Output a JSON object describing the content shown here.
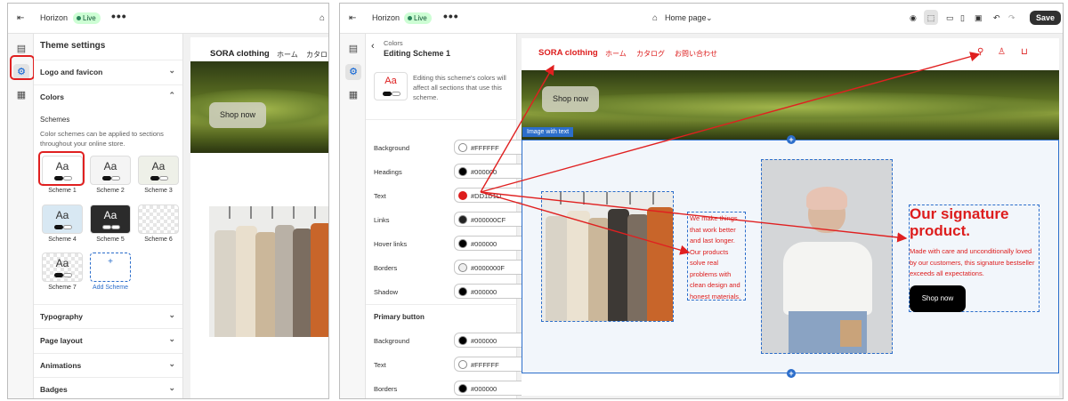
{
  "left": {
    "store": "Horizon",
    "live": "Live",
    "dots": "•••",
    "settings_title": "Theme settings",
    "sections": [
      "Logo and favicon",
      "Colors"
    ],
    "schemes_label": "Schemes",
    "schemes_desc": "Color schemes can be applied to sections throughout your online store.",
    "schemes": [
      {
        "label": "Scheme 1",
        "aa": "Aa"
      },
      {
        "label": "Scheme 2",
        "aa": "Aa"
      },
      {
        "label": "Scheme 3",
        "aa": "Aa"
      },
      {
        "label": "Scheme 4",
        "aa": "Aa"
      },
      {
        "label": "Scheme 5",
        "aa": "Aa"
      },
      {
        "label": "Scheme 6",
        "aa": ""
      },
      {
        "label": "Scheme 7",
        "aa": "Aa"
      }
    ],
    "add_scheme": "Add Scheme",
    "add_plus": "+",
    "bottom_sections": [
      "Typography",
      "Page layout",
      "Animations",
      "Badges"
    ],
    "preview": {
      "brand": "SORA clothing",
      "nav1": "ホーム",
      "nav2": "カタロ",
      "shop_now": "Shop now"
    }
  },
  "right": {
    "store": "Horizon",
    "live": "Live",
    "dots": "•••",
    "page_selector": "Home page",
    "save": "Save",
    "crumb": "Colors",
    "editing": "Editing Scheme 1",
    "scheme_aa": "Aa",
    "scheme_note": "Editing this scheme's colors will affect all sections that use this scheme.",
    "fields": [
      {
        "label": "Background",
        "value": "#FFFFFF",
        "color": "#FFFFFF"
      },
      {
        "label": "Headings",
        "value": "#000000",
        "color": "#000000"
      },
      {
        "label": "Text",
        "value": "#DD1D1D",
        "color": "#DD1D1D"
      },
      {
        "label": "Links",
        "value": "#000000CF",
        "color": "#222222"
      },
      {
        "label": "Hover links",
        "value": "#000000",
        "color": "#000000"
      },
      {
        "label": "Borders",
        "value": "#0000000F",
        "color": "#EEEEEE"
      },
      {
        "label": "Shadow",
        "value": "#000000",
        "color": "#000000"
      }
    ],
    "primary_button": "Primary button",
    "button_fields": [
      {
        "label": "Background",
        "value": "#000000",
        "color": "#000000"
      },
      {
        "label": "Text",
        "value": "#FFFFFF",
        "color": "#FFFFFF"
      },
      {
        "label": "Borders",
        "value": "#000000",
        "color": "#000000"
      }
    ],
    "preview": {
      "brand": "SORA clothing",
      "nav": [
        "ホーム",
        "カタログ",
        "お問い合わせ"
      ],
      "shop_now": "Shop now",
      "section_tag": "Image with text",
      "small_text": "We make things that work better and last longer. Our products solve real problems with clean design and honest materials.",
      "heading": "Our signature product.",
      "body": "Made with care and unconditionally loved by our customers, this signature bestseller exceeds all expectations.",
      "cta": "Shop now"
    }
  },
  "colors": {
    "accent_red": "#DD1D1D",
    "highlight": "#E02020",
    "live_green": "#29845A",
    "selection_blue": "#2C6ECB"
  }
}
